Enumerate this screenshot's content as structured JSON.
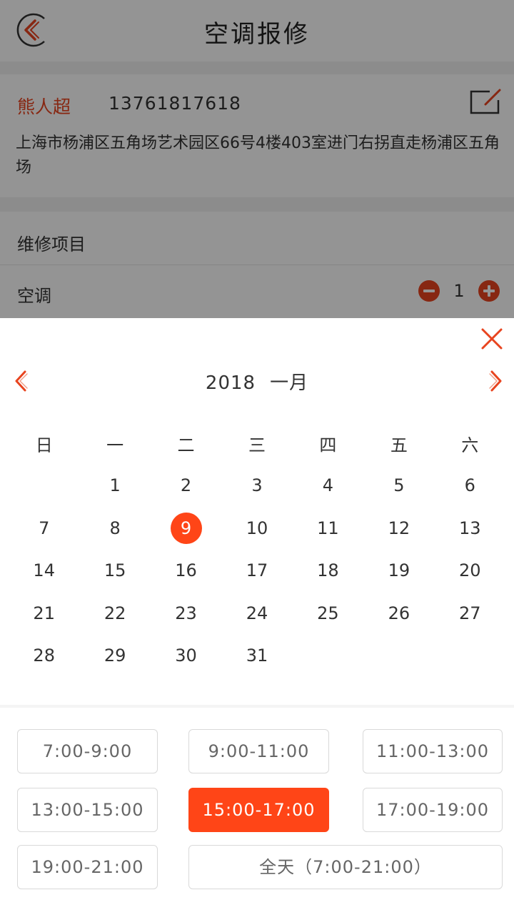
{
  "header": {
    "title": "空调报修",
    "back_icon": "back-arrow-icon"
  },
  "address": {
    "name": "熊人超",
    "phone": "13761817618",
    "line": "上海市杨浦区五角场艺术园区66号4楼403室进门右拐直走杨浦区五角场",
    "edit_icon": "edit-icon"
  },
  "service": {
    "header": "维修项目",
    "item": "空调",
    "quantity": "1",
    "minus_icon": "minus-icon",
    "plus_icon": "plus-icon"
  },
  "calendar": {
    "year": "2018",
    "month": "一月",
    "weekdays": [
      "日",
      "一",
      "二",
      "三",
      "四",
      "五",
      "六"
    ],
    "days": [
      "",
      "1",
      "2",
      "3",
      "4",
      "5",
      "6",
      "7",
      "8",
      "9",
      "10",
      "11",
      "12",
      "13",
      "14",
      "15",
      "16",
      "17",
      "18",
      "19",
      "20",
      "21",
      "22",
      "23",
      "24",
      "25",
      "26",
      "27",
      "28",
      "29",
      "30",
      "31"
    ],
    "selected_day": "9"
  },
  "time_slots": {
    "slots": [
      "7:00-9:00",
      "9:00-11:00",
      "11:00-13:00",
      "13:00-15:00",
      "15:00-17:00",
      "17:00-19:00",
      "19:00-21:00",
      "全天（7:00-21:00）"
    ],
    "selected": "15:00-17:00"
  },
  "colors": {
    "accent": "#ff4517",
    "brand_red": "#e8441f",
    "overlay": "rgba(0,0,0,0.42)"
  }
}
